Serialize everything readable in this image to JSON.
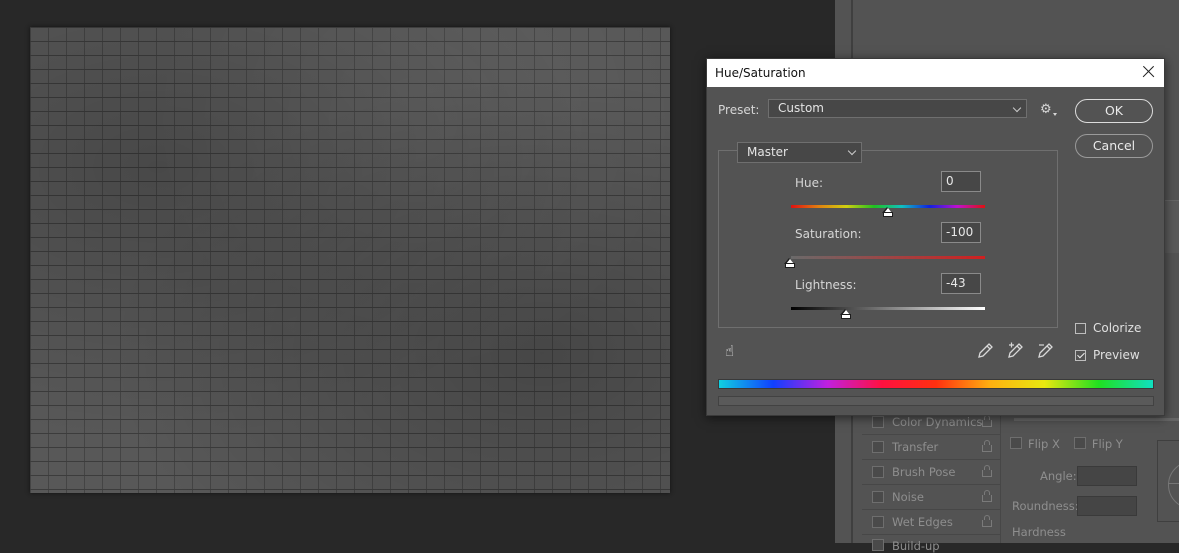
{
  "dialog": {
    "title": "Hue/Saturation",
    "preset_label": "Preset:",
    "preset_value": "Custom",
    "channel_value": "Master",
    "ok_label": "OK",
    "cancel_label": "Cancel",
    "hue_label": "Hue:",
    "hue_value": "0",
    "saturation_label": "Saturation:",
    "saturation_value": "-100",
    "lightness_label": "Lightness:",
    "lightness_value": "-43",
    "colorize_label": "Colorize",
    "colorize_checked": false,
    "preview_label": "Preview",
    "preview_checked": true,
    "icons": [
      "gear-icon",
      "hand-target-icon",
      "eyedropper-icon",
      "eyedropper-plus-icon",
      "eyedropper-minus-icon",
      "close-icon"
    ]
  },
  "brush_panel": {
    "items": [
      {
        "label": "Color Dynamics"
      },
      {
        "label": "Transfer"
      },
      {
        "label": "Brush Pose"
      },
      {
        "label": "Noise"
      },
      {
        "label": "Wet Edges"
      },
      {
        "label": "Build-up"
      }
    ],
    "flip_x_label": "Flip X",
    "flip_y_label": "Flip Y",
    "angle_label": "Angle:",
    "roundness_label": "Roundness:",
    "hardness_label": "Hardness"
  },
  "colors": {
    "workspace_bg": "#282828",
    "panel_bg": "#535353",
    "dialog_titlebar": "#ffffff"
  }
}
